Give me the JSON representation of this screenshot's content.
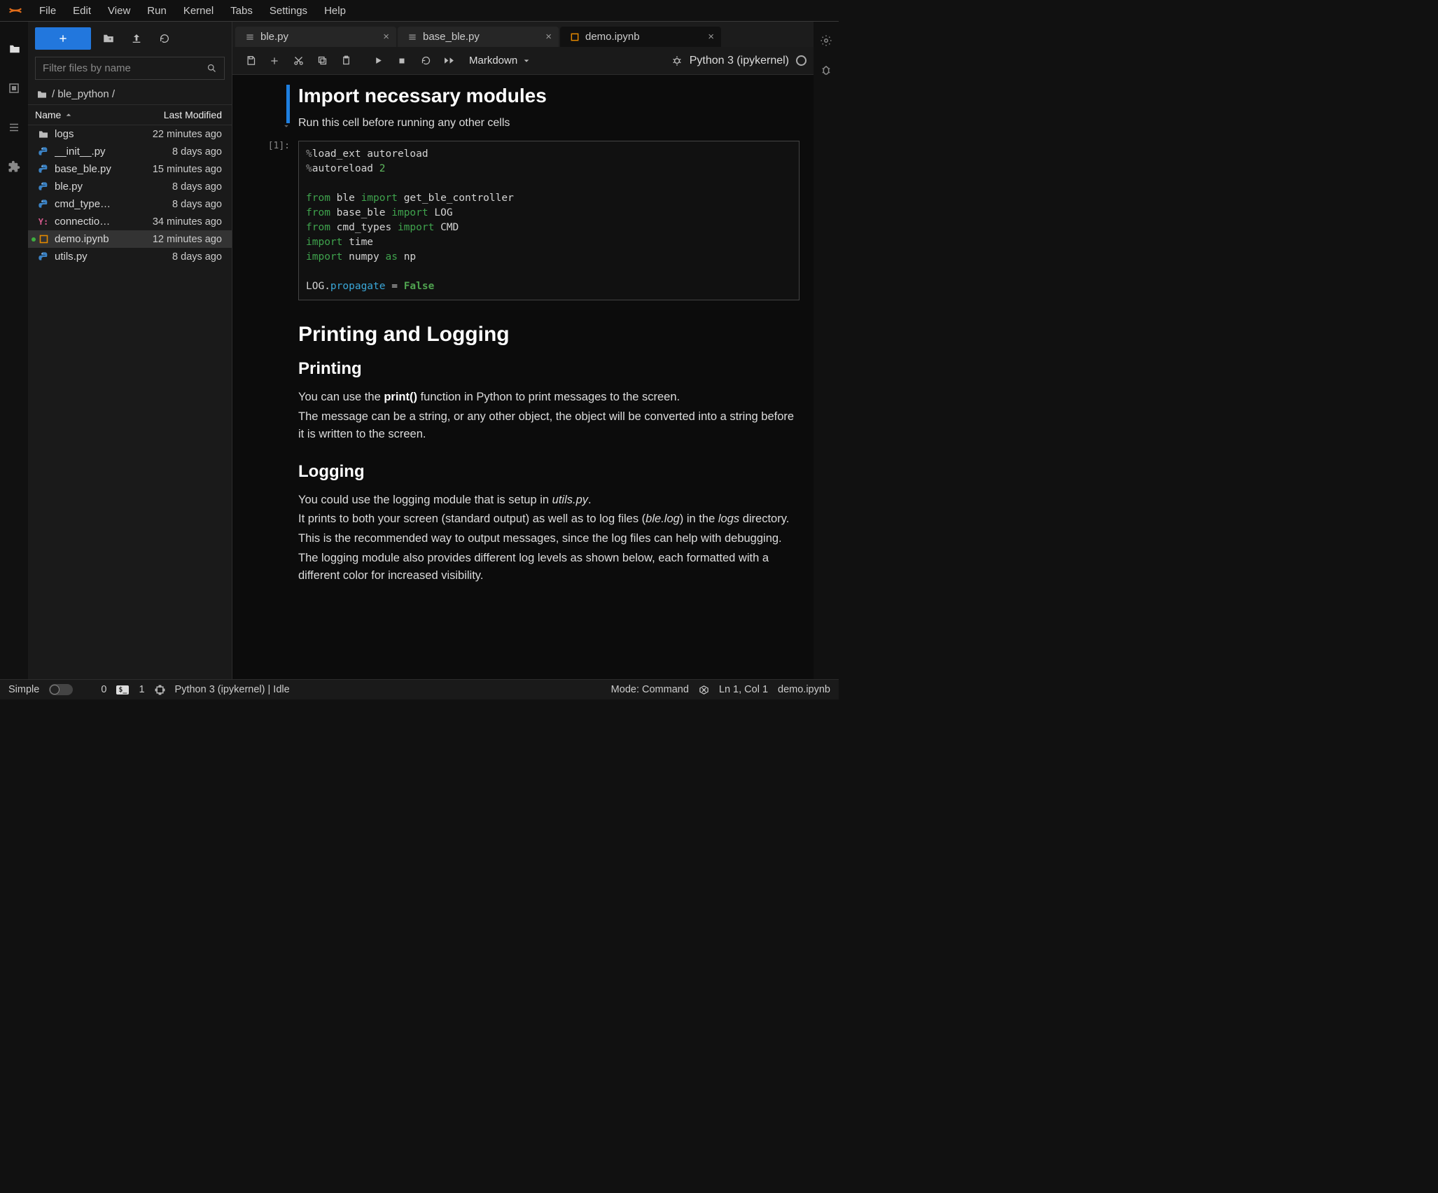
{
  "menu": [
    "File",
    "Edit",
    "View",
    "Run",
    "Kernel",
    "Tabs",
    "Settings",
    "Help"
  ],
  "file_panel": {
    "filter_placeholder": "Filter files by name",
    "breadcrumb": "/ ble_python /",
    "columns": {
      "name": "Name",
      "modified": "Last Modified"
    },
    "files": [
      {
        "icon": "folder",
        "name": "logs",
        "modified": "22 minutes ago"
      },
      {
        "icon": "py",
        "name": "__init__.py",
        "modified": "8 days ago"
      },
      {
        "icon": "py",
        "name": "base_ble.py",
        "modified": "15 minutes ago"
      },
      {
        "icon": "py",
        "name": "ble.py",
        "modified": "8 days ago"
      },
      {
        "icon": "py",
        "name": "cmd_type…",
        "modified": "8 days ago"
      },
      {
        "icon": "yaml",
        "name": "connectio…",
        "modified": "34 minutes ago"
      },
      {
        "icon": "nb",
        "name": "demo.ipynb",
        "modified": "12 minutes ago",
        "running": true,
        "selected": true
      },
      {
        "icon": "py",
        "name": "utils.py",
        "modified": "8 days ago"
      }
    ]
  },
  "tabs": [
    {
      "kind": "py",
      "label": "ble.py",
      "active": false
    },
    {
      "kind": "py",
      "label": "base_ble.py",
      "active": false
    },
    {
      "kind": "nb",
      "label": "demo.ipynb",
      "active": true
    }
  ],
  "toolbar": {
    "celltype": "Markdown",
    "kernel": "Python 3 (ipykernel)"
  },
  "cells": {
    "md1_title": "Import necessary modules",
    "md1_text": "Run this cell before running any other cells",
    "code1_prompt": "[1]:",
    "md2_h1": "Printing and Logging",
    "md2_h2a": "Printing",
    "md2_p1a": "You can use the ",
    "md2_p1b": "print()",
    "md2_p1c": " function in Python to print messages to the screen.",
    "md2_p2": "The message can be a string, or any other object, the object will be converted into a string before it is written to the screen.",
    "md2_h2b": "Logging",
    "md2_p3a": "You could use the logging module that is setup in ",
    "md2_p3b": "utils.py",
    "md2_p3c": ".",
    "md2_p4a": "It prints to both your screen (standard output) as well as to log files (",
    "md2_p4b": "ble.log",
    "md2_p4c": ") in the ",
    "md2_p4d": "logs",
    "md2_p4e": " directory.",
    "md2_p5": "This is the recommended way to output messages, since the log files can help with debugging.",
    "md2_p6": "The logging module also provides different log levels as shown below, each formatted with a different color for increased visibility."
  },
  "code1_lines": [
    {
      "tokens": [
        {
          "t": "%",
          "c": "c-magic"
        },
        {
          "t": "load_ext autoreload",
          "c": ""
        }
      ]
    },
    {
      "tokens": [
        {
          "t": "%",
          "c": "c-magic"
        },
        {
          "t": "autoreload ",
          "c": ""
        },
        {
          "t": "2",
          "c": "c-num"
        }
      ]
    },
    {
      "blank": true
    },
    {
      "tokens": [
        {
          "t": "from",
          "c": "c-kw"
        },
        {
          "t": " ble ",
          "c": ""
        },
        {
          "t": "import",
          "c": "c-kw"
        },
        {
          "t": " get_ble_controller",
          "c": ""
        }
      ]
    },
    {
      "tokens": [
        {
          "t": "from",
          "c": "c-kw"
        },
        {
          "t": " base_ble ",
          "c": ""
        },
        {
          "t": "import",
          "c": "c-kw"
        },
        {
          "t": " LOG",
          "c": ""
        }
      ]
    },
    {
      "tokens": [
        {
          "t": "from",
          "c": "c-kw"
        },
        {
          "t": " cmd_types ",
          "c": ""
        },
        {
          "t": "import",
          "c": "c-kw"
        },
        {
          "t": " CMD",
          "c": ""
        }
      ]
    },
    {
      "tokens": [
        {
          "t": "import",
          "c": "c-kw"
        },
        {
          "t": " time",
          "c": ""
        }
      ]
    },
    {
      "tokens": [
        {
          "t": "import",
          "c": "c-kw"
        },
        {
          "t": " numpy ",
          "c": ""
        },
        {
          "t": "as",
          "c": "c-kw"
        },
        {
          "t": " np",
          "c": ""
        }
      ]
    },
    {
      "blank": true
    },
    {
      "tokens": [
        {
          "t": "LOG.",
          "c": ""
        },
        {
          "t": "propagate",
          "c": "c-attr"
        },
        {
          "t": " ",
          "c": ""
        },
        {
          "t": "=",
          "c": "c-op"
        },
        {
          "t": " ",
          "c": ""
        },
        {
          "t": "False",
          "c": "c-bool"
        }
      ]
    }
  ],
  "footer": {
    "simple": "Simple",
    "count0": "0",
    "count1": "1",
    "kernel_status": "Python 3 (ipykernel) | Idle",
    "mode": "Mode: Command",
    "cursor": "Ln 1, Col 1",
    "file": "demo.ipynb"
  }
}
